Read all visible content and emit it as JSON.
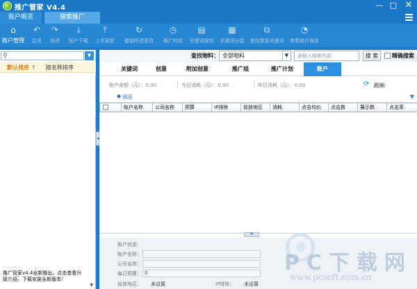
{
  "app": {
    "title": "推广管家 V4.4"
  },
  "top_tabs": [
    {
      "label": "账户概览"
    },
    {
      "label": "搜索推广"
    }
  ],
  "toolbar": [
    {
      "label": "账户管理",
      "icon": "home-icon"
    },
    {
      "label": "后退",
      "icon": "undo-icon"
    },
    {
      "label": "前进",
      "icon": "redo-icon"
    },
    {
      "label": "账户下载",
      "icon": "download-icon"
    },
    {
      "label": "上传更新",
      "icon": "upload-icon"
    },
    {
      "label": "撤销所选更改",
      "icon": "revert-icon"
    },
    {
      "label": "推广时段",
      "icon": "clock-icon"
    },
    {
      "label": "关键词规划",
      "icon": "chart-icon"
    },
    {
      "label": "关键词分组",
      "icon": "grid-icon"
    },
    {
      "label": "查找重复关键词",
      "icon": "duplicate-icon"
    },
    {
      "label": "查看统计报告",
      "icon": "pie-icon"
    }
  ],
  "search": {
    "label": "查找物料：",
    "material_value": "全部物料",
    "placeholder": "请输入搜索内容",
    "button": "搜 索",
    "exact_label": "精确搜索"
  },
  "left": {
    "sort_default": "默认排序 ↑",
    "sort_name": "按名称排序",
    "footer_line1": "推广管家v4.4全新推出，点击查看升",
    "footer_line2": "级介绍，下载安装全新版本！"
  },
  "sub_tabs": [
    "关键词",
    "创意",
    "附加创意",
    "推广组",
    "推广计划",
    "账户"
  ],
  "stats": {
    "balance": "账户余额（元）：0.00",
    "today": "今日消耗（元）：0.00",
    "yesterday": "昨日消耗（元）：0.00",
    "refresh": "刷新"
  },
  "return_label": "返回",
  "grid_columns": [
    "账户名称",
    "公司名称",
    "预算",
    "IP排除",
    "投放地区",
    "消耗",
    "点击均价",
    "点击数",
    "展示数",
    "点击率"
  ],
  "detail": {
    "status_label": "账户状态：",
    "account_label": "账户名称：",
    "company_label": "公司名称：",
    "budget_label": "每日预算：",
    "budget_value": "0",
    "region_label": "投放地区：",
    "region_value": "未设置",
    "ip_label": "IP排除：",
    "ip_value": "未设置"
  },
  "watermark": {
    "text": "PC下载网",
    "url": "www.pcsoft.com.cn"
  }
}
